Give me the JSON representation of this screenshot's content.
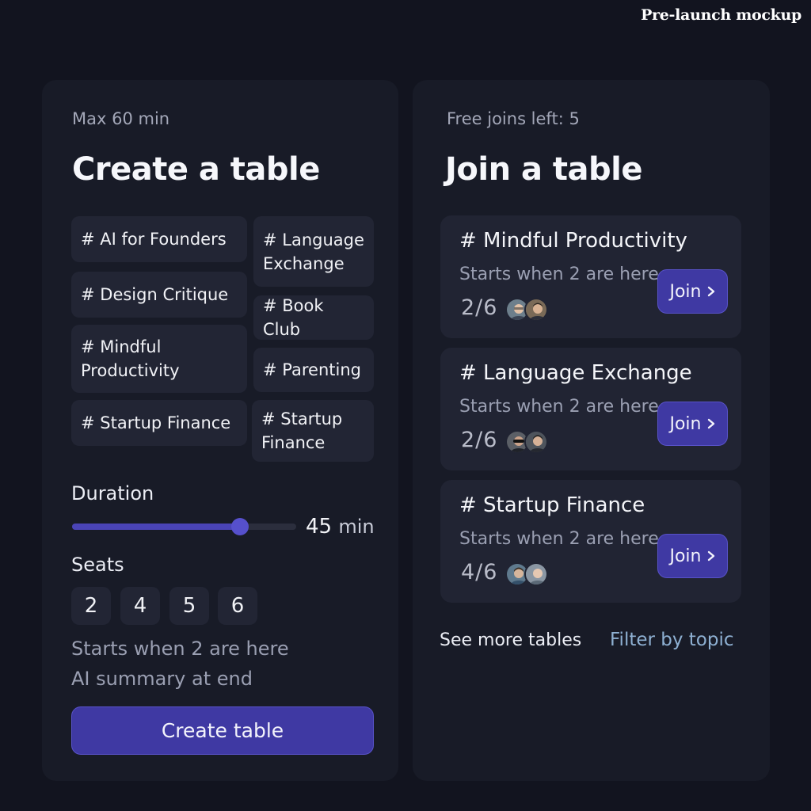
{
  "watermark": "Pre-launch mockup",
  "create": {
    "meta": "Max 60 min",
    "title": "Create a table",
    "topics": [
      "# AI for Founders",
      "# Language\nExchange",
      "# Design Critique",
      "# Book Club",
      "# Mindful\nProductivity",
      "# Parenting",
      "# Startup Finance",
      "# Startup\nFinance"
    ],
    "duration_label": "Duration",
    "duration_value": "45",
    "duration_unit": "min",
    "duration_fraction": 0.75,
    "seats_label": "Seats",
    "seats": [
      "2",
      "4",
      "5",
      "6"
    ],
    "hint_start": "Starts when 2 are here",
    "hint_summary": "AI summary at end",
    "button_label": "Create table",
    "accent_color": "#3f39a3"
  },
  "join": {
    "meta": "Free joins left: 5",
    "title": "Join a table",
    "tables": [
      {
        "title": "# Mindful Productivity",
        "hint": "Starts when 2 are here",
        "count": "2/6",
        "join_label": "Join",
        "avatars": [
          "person-avatar",
          "person-avatar"
        ]
      },
      {
        "title": "# Language Exchange",
        "hint": "Starts when 2 are here",
        "count": "2/6",
        "join_label": "Join",
        "avatars": [
          "person-avatar",
          "person-avatar"
        ]
      },
      {
        "title": "# Startup Finance",
        "hint": "Starts when 2 are here",
        "count": "4/6",
        "join_label": "Join",
        "avatars": [
          "person-avatar",
          "person-avatar"
        ]
      }
    ],
    "see_more": "See more tables",
    "filter": "Filter by topic"
  }
}
